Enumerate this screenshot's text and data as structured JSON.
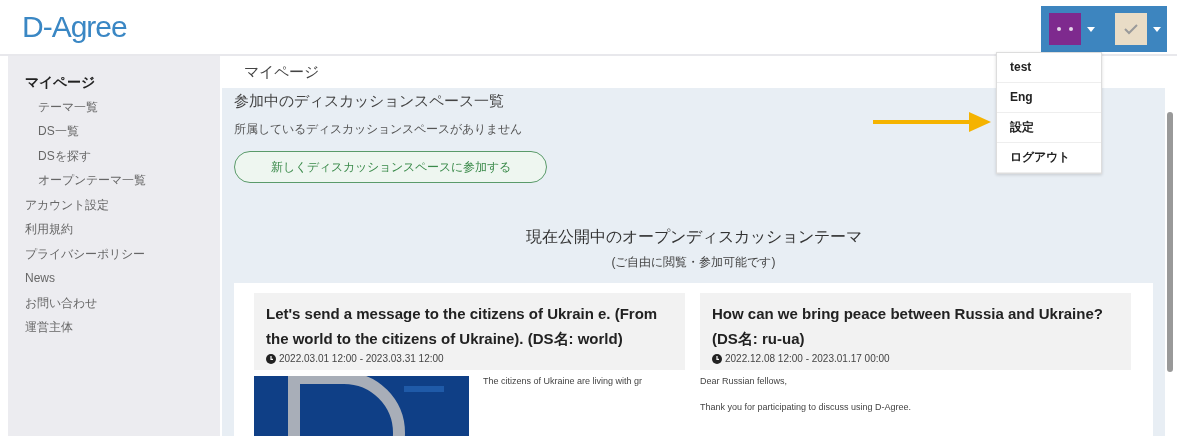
{
  "header": {
    "logo": "D-Agree"
  },
  "user_menu": {
    "items": [
      {
        "label": "test"
      },
      {
        "label": "Eng"
      },
      {
        "label": "設定"
      },
      {
        "label": "ログアウト"
      }
    ]
  },
  "sidebar": {
    "items": [
      {
        "label": "マイページ",
        "selected": true,
        "children": [
          {
            "label": "テーマ一覧",
            "selected": false
          },
          {
            "label": "DS一覧",
            "selected": false
          },
          {
            "label": "DSを探す",
            "selected": false
          },
          {
            "label": "オープンテーマ一覧",
            "selected": false
          }
        ]
      },
      {
        "label": "アカウント設定",
        "selected": false
      },
      {
        "label": "利用規約",
        "selected": false
      },
      {
        "label": "プライバシーポリシー",
        "selected": false
      },
      {
        "label": "News",
        "selected": false
      },
      {
        "label": "お問い合わせ",
        "selected": false
      },
      {
        "label": "運営主体",
        "selected": false
      }
    ]
  },
  "page_title": "マイページ",
  "joined": {
    "heading": "参加中のディスカッションスペース一覧",
    "empty_message": "所属しているディスカッションスペースがありません",
    "join_button": "新しくディスカッションスペースに参加する"
  },
  "open_themes": {
    "heading": "現在公開中のオープンディスカッションテーマ",
    "subheading": "(ご自由に閲覧・参加可能です)",
    "cards": [
      {
        "title": "Let's send a message to the citizens of Ukrain e. (From the world to the citizens of Ukraine). (DS名: world)",
        "period": "2022.03.01 12:00 - 2023.03.31 12:00",
        "has_picture": true,
        "body": [
          "The citizens of Ukraine are living with gr"
        ]
      },
      {
        "title": "How can we bring peace between Russia and Ukraine? (DS名: ru-ua)",
        "period": "2022.12.08 12:00 - 2023.01.17 00:00",
        "has_picture": false,
        "body": [
          "Dear Russian fellows,",
          "Thank you for participating to discuss using D-Agree."
        ]
      }
    ]
  }
}
